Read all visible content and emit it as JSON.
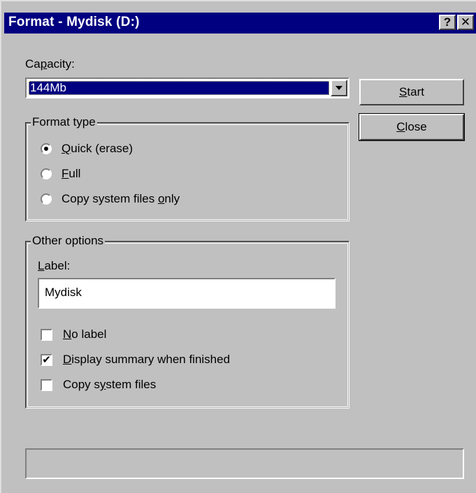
{
  "window": {
    "title": "Format - Mydisk (D:)",
    "help_button": "?",
    "close_button": "✕"
  },
  "capacity": {
    "label_pre": "Ca",
    "label_accel": "p",
    "label_post": "acity:",
    "selected": "144Mb"
  },
  "buttons": {
    "start_accel": "S",
    "start_rest": "tart",
    "close_accel": "C",
    "close_rest": "lose"
  },
  "format_type": {
    "legend": "Format type",
    "options": [
      {
        "accel": "Q",
        "rest": "uick (erase)",
        "selected": true
      },
      {
        "accel": "F",
        "rest": "ull",
        "selected": false
      },
      {
        "pre": "Copy system files ",
        "accel": "o",
        "rest": "nly",
        "selected": false
      }
    ]
  },
  "other_options": {
    "legend": "Other options",
    "label_accel": "L",
    "label_rest": "abel:",
    "label_value": "Mydisk",
    "checkboxes": [
      {
        "accel": "N",
        "rest": "o label",
        "checked": false
      },
      {
        "accel": "D",
        "rest": "isplay summary when finished",
        "checked": true
      },
      {
        "pre": "Copy s",
        "accel": "y",
        "rest": "stem files",
        "checked": false
      }
    ]
  },
  "colors": {
    "titlebar": "#000080",
    "face": "#c0c0c0"
  }
}
